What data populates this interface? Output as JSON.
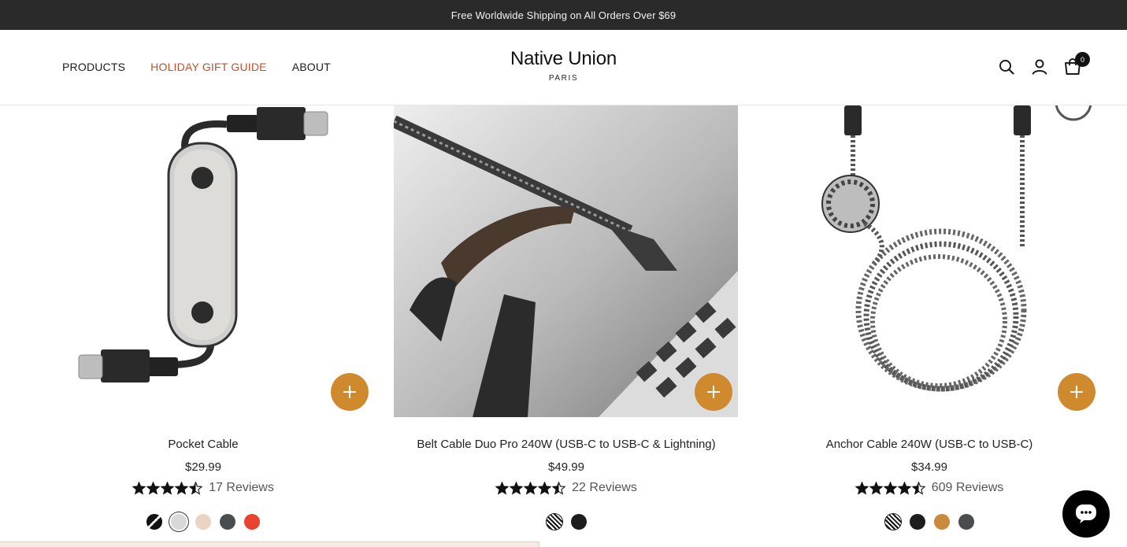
{
  "announcement": "Free Worldwide Shipping on All Orders Over $69",
  "nav": {
    "products": "PRODUCTS",
    "gift_guide": "HOLIDAY GIFT GUIDE",
    "about": "ABOUT"
  },
  "brand": {
    "name": "Native Union",
    "city": "PARIS"
  },
  "header_icons": [
    "search-icon",
    "account-icon",
    "cart-icon"
  ],
  "cart": {
    "count": "0"
  },
  "colors": {
    "accent": "#c0502c",
    "add_button": "#d08a2e",
    "announce_bg": "#2a2a2a"
  },
  "products": [
    {
      "title": "Pocket Cable",
      "price": "$29.99",
      "rating": 4.5,
      "reviews": "17 Reviews",
      "swatches": [
        "#111111",
        "#d8d8d8",
        "#ecd2c2",
        "#4a4d4e",
        "#e8432f"
      ]
    },
    {
      "title": "Belt Cable Duo Pro 240W (USB-C to USB-C & Lightning)",
      "price": "$49.99",
      "rating": 4.5,
      "reviews": "22 Reviews",
      "swatches": [
        "zebra",
        "#1d1d1d"
      ]
    },
    {
      "title": "Anchor Cable 240W (USB-C to USB-C)",
      "price": "$34.99",
      "rating": 4.5,
      "reviews": "609 Reviews",
      "swatches": [
        "zebra",
        "#1d1d1d",
        "#c98a3e",
        "#4a4d4e"
      ]
    }
  ]
}
